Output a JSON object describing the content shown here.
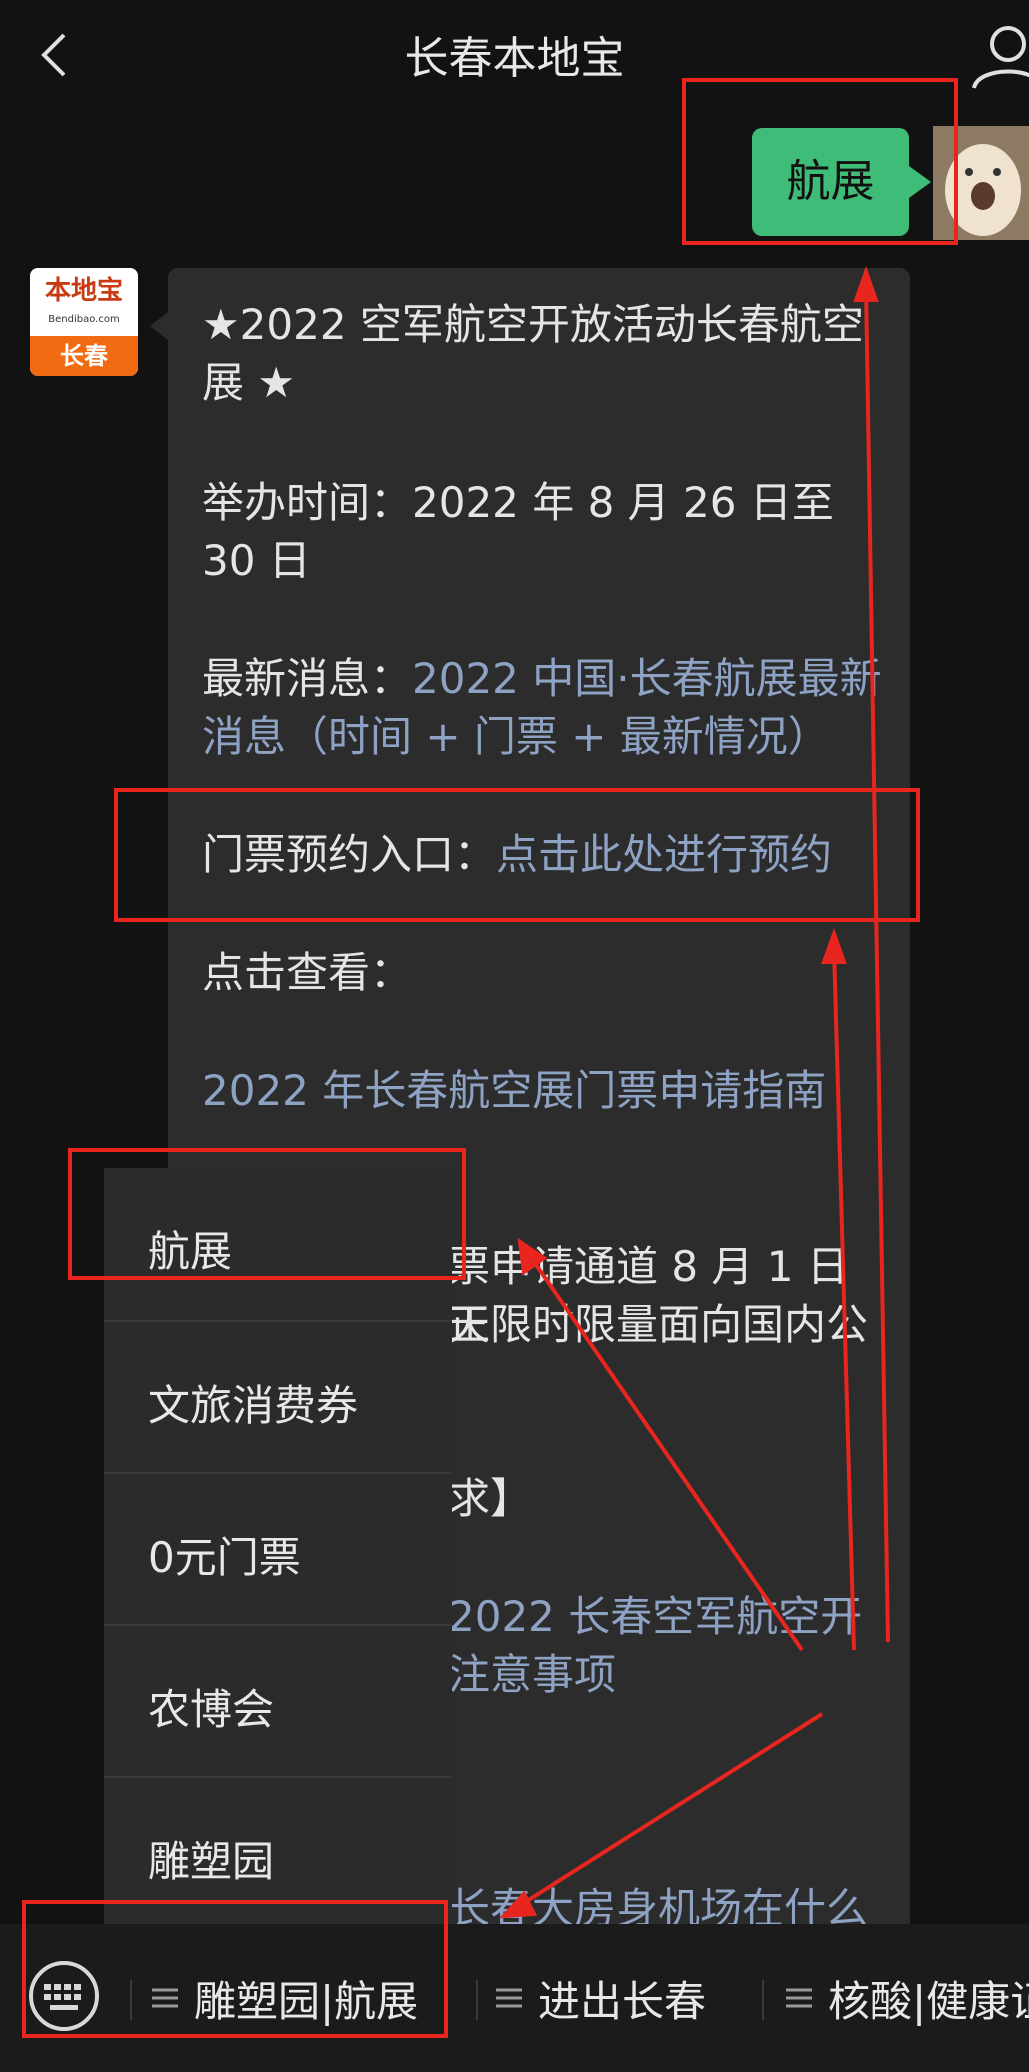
{
  "header": {
    "title": "长春本地宝",
    "back_icon": "chevron-left-icon",
    "profile_icon": "person-icon"
  },
  "user_message": {
    "text": "航展",
    "bubble_color": "#3fbd78"
  },
  "bot": {
    "avatar": {
      "logo_text": "本地宝",
      "logo_url": "Bendibao.com",
      "city": "长春"
    },
    "lines": {
      "title": "★2022 空军航空开放活动长春航空展 ★",
      "time_label": "举办时间：",
      "time_value": "2022 年 8 月 26 日至 30 日",
      "news_label": "最新消息：",
      "news_link": "2022 中国·长春航展最新消息（时间 + 门票 + 最新情况）",
      "ticket_label": "门票预约入口：",
      "ticket_link": "点击此处进行预约",
      "view_label": "点击查看：",
      "guide_link": "2022 年长春航空展门票申请指南",
      "partial_1": "票申请通道 8 月 1 日正",
      "partial_2": "天限时限量面向国内公",
      "partial_3": "求】",
      "partial_4": "2022 长春空军航空开",
      "partial_5": "注意事项",
      "partial_6": "长春大房身机场在什么"
    }
  },
  "menu": {
    "items": [
      "航展",
      "文旅消费券",
      "0元门票",
      "农博会",
      "雕塑园"
    ]
  },
  "bottom_bar": {
    "keyboard_icon": "keyboard-icon",
    "items": [
      "雕塑园|航展",
      "进出长春",
      "核酸|健康证"
    ]
  },
  "annotation_color": "#e8261f"
}
